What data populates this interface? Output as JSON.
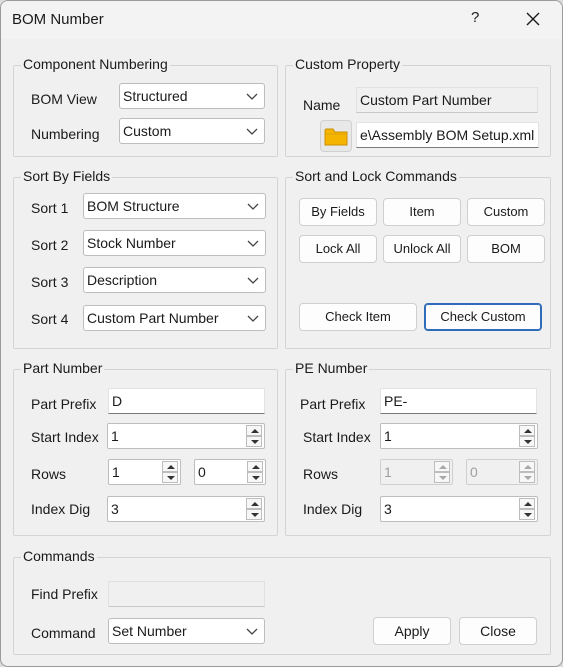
{
  "window": {
    "title": "BOM Number",
    "help_glyph": "?"
  },
  "component_numbering": {
    "title": "Component Numbering",
    "bom_view_label": "BOM View",
    "bom_view_value": "Structured",
    "numbering_label": "Numbering",
    "numbering_value": "Custom"
  },
  "custom_property": {
    "title": "Custom Property",
    "name_label": "Name",
    "name_value": "Custom Part Number",
    "file_value": "e\\Assembly BOM Setup.xml"
  },
  "sort_by_fields": {
    "title": "Sort By Fields",
    "sorts": [
      {
        "label": "Sort 1",
        "value": "BOM Structure"
      },
      {
        "label": "Sort 2",
        "value": "Stock Number"
      },
      {
        "label": "Sort 3",
        "value": "Description"
      },
      {
        "label": "Sort 4",
        "value": "Custom Part Number"
      }
    ]
  },
  "sort_lock": {
    "title": "Sort and Lock Commands",
    "by_fields": "By Fields",
    "item": "Item",
    "custom": "Custom",
    "lock_all": "Lock All",
    "unlock_all": "Unlock All",
    "bom": "BOM",
    "check_item": "Check Item",
    "check_custom": "Check Custom"
  },
  "part_number": {
    "title": "Part Number",
    "prefix_label": "Part Prefix",
    "prefix_value": "D",
    "start_label": "Start Index",
    "start_value": "1",
    "rows_label": "Rows",
    "rows_value_1": "1",
    "rows_value_2": "0",
    "index_dig_label": "Index Dig",
    "index_dig_value": "3"
  },
  "pe_number": {
    "title": "PE Number",
    "prefix_label": "Part Prefix",
    "prefix_value": "PE-",
    "start_label": "Start Index",
    "start_value": "1",
    "rows_label": "Rows",
    "rows_value_1": "1",
    "rows_value_2": "0",
    "index_dig_label": "Index Dig",
    "index_dig_value": "3"
  },
  "commands": {
    "title": "Commands",
    "find_prefix_label": "Find Prefix",
    "find_prefix_value": "",
    "command_label": "Command",
    "command_value": "Set Number",
    "apply": "Apply",
    "close": "Close"
  },
  "colors": {
    "folder": "#f5b400",
    "focus_border": "#2e6bb8"
  }
}
